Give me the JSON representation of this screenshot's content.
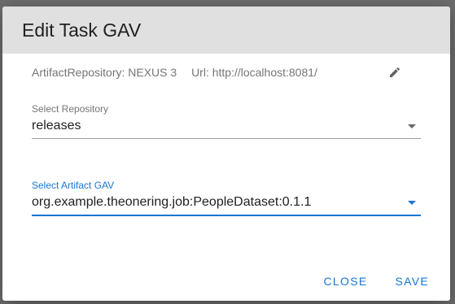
{
  "dialog": {
    "title": "Edit Task GAV",
    "artifact_repository": "ArtifactRepository: NEXUS 3",
    "url": "Url: http://localhost:8081/",
    "repository_field": {
      "label": "Select Repository",
      "value": "releases"
    },
    "gav_field": {
      "label": "Select Artifact GAV",
      "value": "org.example.theonering.job:PeopleDataset:0.1.1"
    },
    "close_label": "CLOSE",
    "save_label": "SAVE"
  },
  "colors": {
    "accent": "#1976d2",
    "header_bg": "#e0e0e0"
  },
  "icons": {
    "edit": "pencil-icon",
    "dropdown": "caret-down-icon"
  }
}
